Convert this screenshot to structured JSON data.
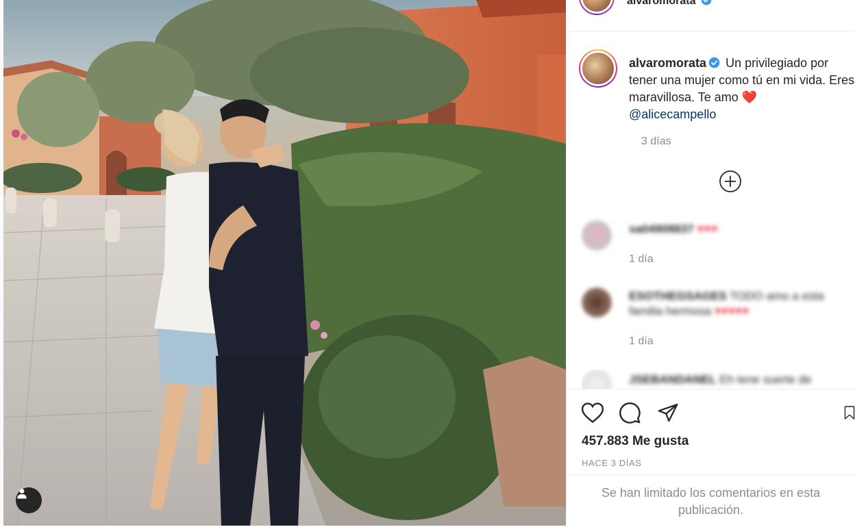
{
  "post": {
    "username": "alvaromorata",
    "verified": true,
    "caption": "Un privilegiado por tener una mujer como tú en mi vida. Eres maravillosa. Te amo",
    "caption_emoji": "❤️",
    "mention": "@alicecampello",
    "caption_age": "3 días",
    "likes": "457.883 Me gusta",
    "posted": "HACE 3 DÍAS",
    "comments_notice": "Se han limitado los comentarios en esta publicación."
  },
  "comments": [
    {
      "username": "sa04908837",
      "text": "♥♥♥",
      "age": "1 día"
    },
    {
      "username": "ESOTHEGSAGES",
      "text": "TODO amo a esta familia hermosa",
      "hearts": "♥♥♥♥♥",
      "age": "1 día"
    },
    {
      "username": "JSEBANDANEL",
      "text": "Eh tene suerte de"
    }
  ],
  "icons": {
    "like": "heart-outline-icon",
    "comment": "speech-bubble-icon",
    "share": "paper-plane-icon",
    "save": "bookmark-icon",
    "load_more": "plus-circle-icon",
    "user_tag": "person-icon",
    "verified": "verified-badge-icon"
  },
  "colors": {
    "verified": "#3897f0",
    "mention": "#00376b",
    "secondary_text": "#8e8e8e",
    "heart": "#ed4956"
  }
}
